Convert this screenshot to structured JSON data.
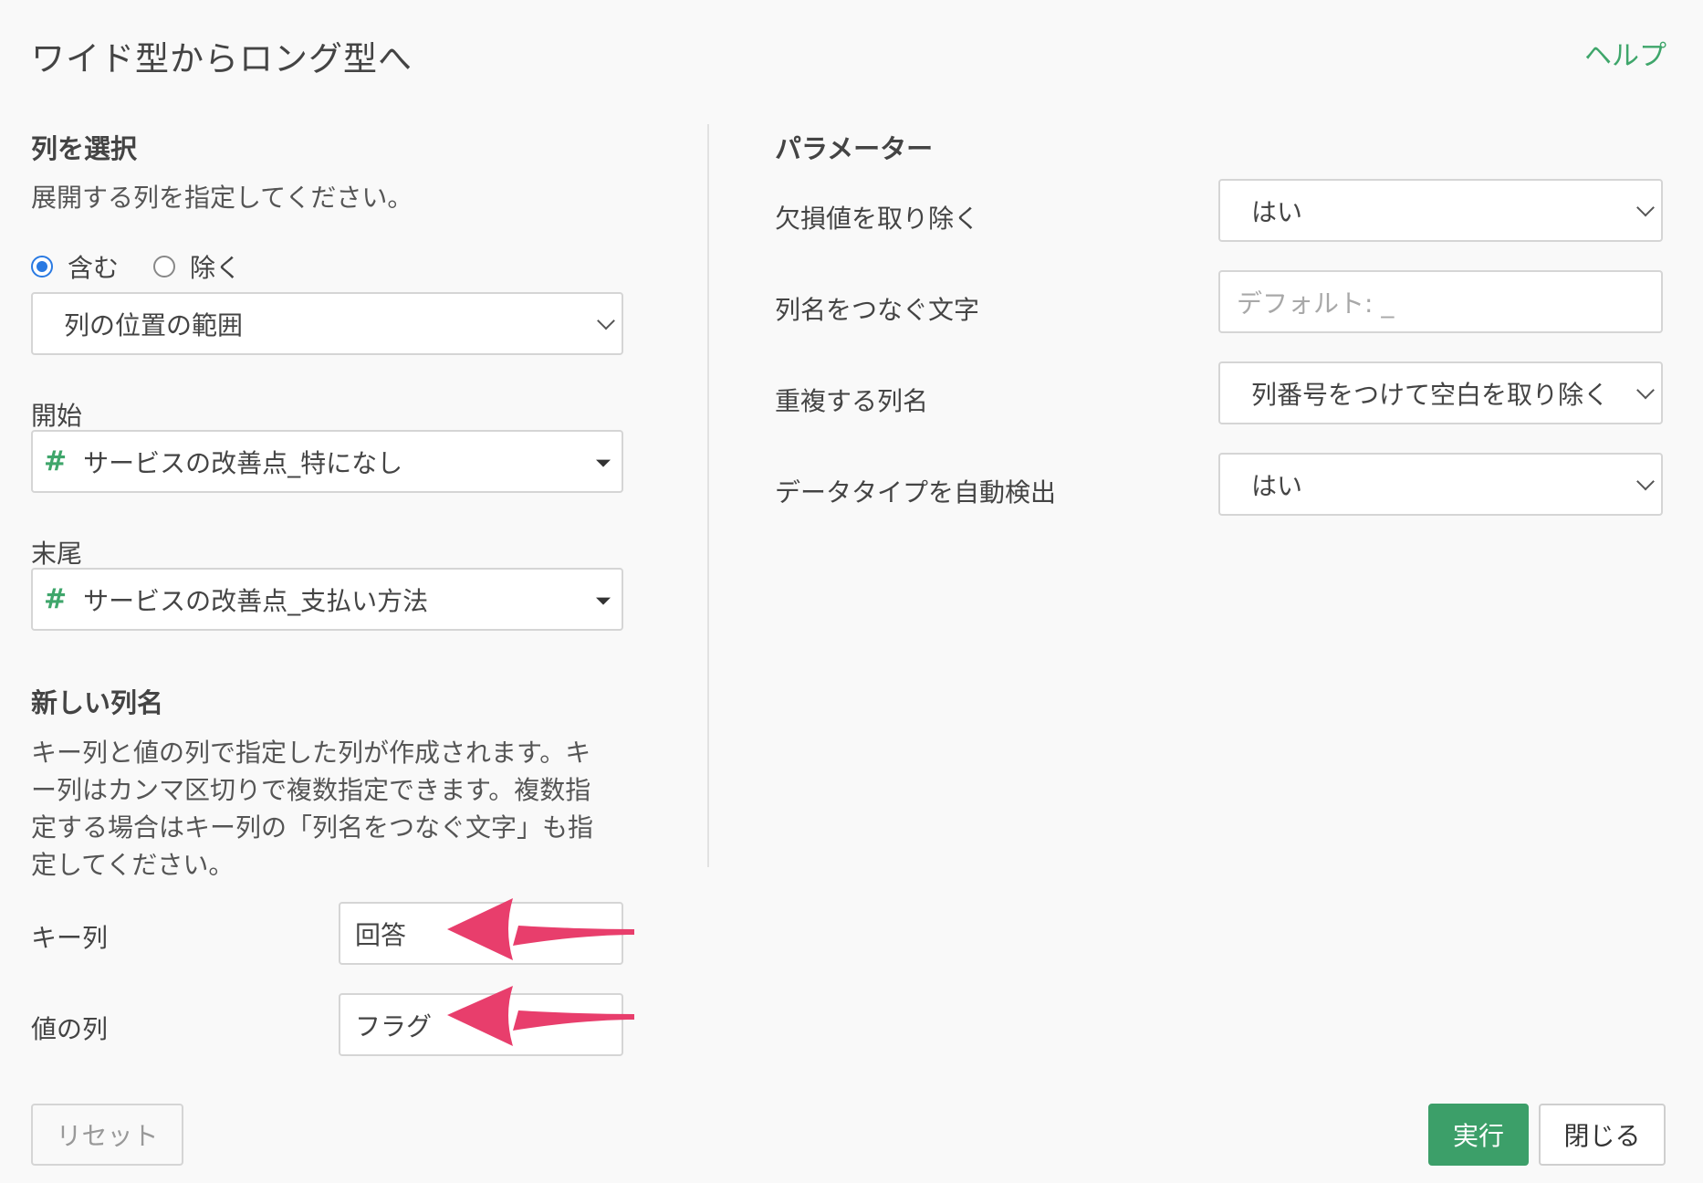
{
  "header": {
    "title": "ワイド型からロング型へ",
    "help_link": "ヘルプ"
  },
  "select_columns": {
    "heading": "列を選択",
    "description": "展開する列を指定してください。",
    "radio_include": "含む",
    "radio_exclude": "除く",
    "radio_selected": "含む",
    "mode_select_value": "列の位置の範囲",
    "start_label": "開始",
    "start_value": "サービスの改善点_特になし",
    "end_label": "末尾",
    "end_value": "サービスの改善点_支払い方法",
    "column_type_icon": "#"
  },
  "new_column_names": {
    "heading": "新しい列名",
    "description": "キー列と値の列で指定した列が作成されます。キー列はカンマ区切りで複数指定できます。複数指定する場合はキー列の「列名をつなぐ文字」も指定してください。",
    "key_label": "キー列",
    "key_value": "回答",
    "value_label": "値の列",
    "value_value": "フラグ"
  },
  "parameters": {
    "heading": "パラメーター",
    "remove_na_label": "欠損値を取り除く",
    "remove_na_value": "はい",
    "separator_label": "列名をつなぐ文字",
    "separator_placeholder": "デフォルト: _",
    "duplicate_label": "重複する列名",
    "duplicate_value": "列番号をつけて空白を取り除く",
    "auto_type_label": "データタイプを自動検出",
    "auto_type_value": "はい"
  },
  "footer": {
    "reset_label": "リセット",
    "run_label": "実行",
    "close_label": "閉じる"
  },
  "colors": {
    "accent_green": "#3c9f69",
    "radio_blue": "#2a7ae2",
    "annotation_arrow": "#e83e6c"
  }
}
